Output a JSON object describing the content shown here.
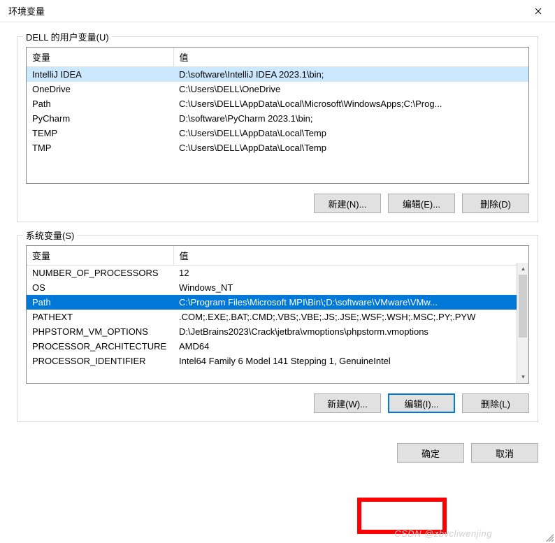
{
  "title": "环境变量",
  "user_section": {
    "legend": "DELL 的用户变量(U)",
    "headers": {
      "variable": "变量",
      "value": "值"
    },
    "rows": [
      {
        "variable": "IntelliJ IDEA",
        "value": "D:\\software\\IntelliJ IDEA 2023.1\\bin;",
        "highlighted": true
      },
      {
        "variable": "OneDrive",
        "value": "C:\\Users\\DELL\\OneDrive"
      },
      {
        "variable": "Path",
        "value": "C:\\Users\\DELL\\AppData\\Local\\Microsoft\\WindowsApps;C:\\Prog..."
      },
      {
        "variable": "PyCharm",
        "value": "D:\\software\\PyCharm 2023.1\\bin;"
      },
      {
        "variable": "TEMP",
        "value": "C:\\Users\\DELL\\AppData\\Local\\Temp"
      },
      {
        "variable": "TMP",
        "value": "C:\\Users\\DELL\\AppData\\Local\\Temp"
      }
    ],
    "buttons": {
      "new": "新建(N)...",
      "edit": "编辑(E)...",
      "delete": "删除(D)"
    }
  },
  "system_section": {
    "legend": "系统变量(S)",
    "headers": {
      "variable": "变量",
      "value": "值"
    },
    "rows": [
      {
        "variable": "NUMBER_OF_PROCESSORS",
        "value": "12"
      },
      {
        "variable": "OS",
        "value": "Windows_NT"
      },
      {
        "variable": "Path",
        "value": "C:\\Program Files\\Microsoft MPI\\Bin\\;D:\\software\\VMware\\VMw...",
        "selected": true
      },
      {
        "variable": "PATHEXT",
        "value": ".COM;.EXE;.BAT;.CMD;.VBS;.VBE;.JS;.JSE;.WSF;.WSH;.MSC;.PY;.PYW"
      },
      {
        "variable": "PHPSTORM_VM_OPTIONS",
        "value": "D:\\JetBrains2023\\Crack\\jetbra\\vmoptions\\phpstorm.vmoptions"
      },
      {
        "variable": "PROCESSOR_ARCHITECTURE",
        "value": "AMD64"
      },
      {
        "variable": "PROCESSOR_IDENTIFIER",
        "value": "Intel64 Family 6 Model 141 Stepping 1, GenuineIntel"
      }
    ],
    "buttons": {
      "new": "新建(W)...",
      "edit": "编辑(I)...",
      "delete": "删除(L)"
    }
  },
  "dialog_buttons": {
    "ok": "确定",
    "cancel": "取消"
  },
  "watermark": "CSDN @zbvcliwenjing"
}
